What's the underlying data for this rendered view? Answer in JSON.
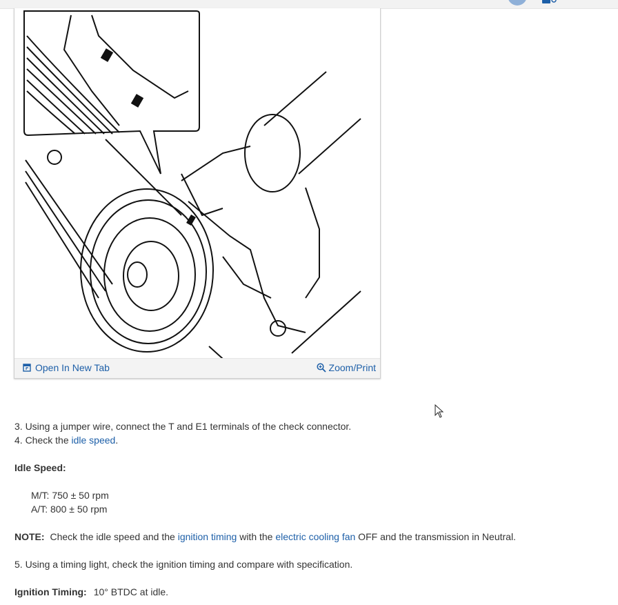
{
  "window": {
    "header_icons": [
      "avatar-icon",
      "chat-icon"
    ],
    "accent": "#1d5fa8"
  },
  "figure": {
    "image_alt": "engine timing mark diagram",
    "open_tab_label": "Open In New Tab",
    "zoom_label": "Zoom/Print",
    "icons": [
      "open-new-tab-icon",
      "zoom-icon"
    ]
  },
  "steps": {
    "step3": "3.  Using a jumper wire, connect the T and E1 terminals of the check connector.",
    "step4_prefix": "4.  Check the ",
    "step4_link": "idle speed",
    "step4_suffix": "."
  },
  "idle": {
    "heading": "Idle Speed:",
    "mt": "M/T: 750 ± 50 rpm",
    "at": "A/T: 800 ± 50 rpm"
  },
  "note": {
    "label": "NOTE:",
    "text1": " Check the idle speed and the ",
    "link1": "ignition timing",
    "text2": " with the ",
    "link2": "electric cooling fan",
    "text3": " OFF and the transmission in Neutral."
  },
  "step5": "5.  Using a timing light, check the ignition timing and compare with specification.",
  "timing": {
    "label": "Ignition Timing:",
    "value": "10° BTDC at idle."
  }
}
